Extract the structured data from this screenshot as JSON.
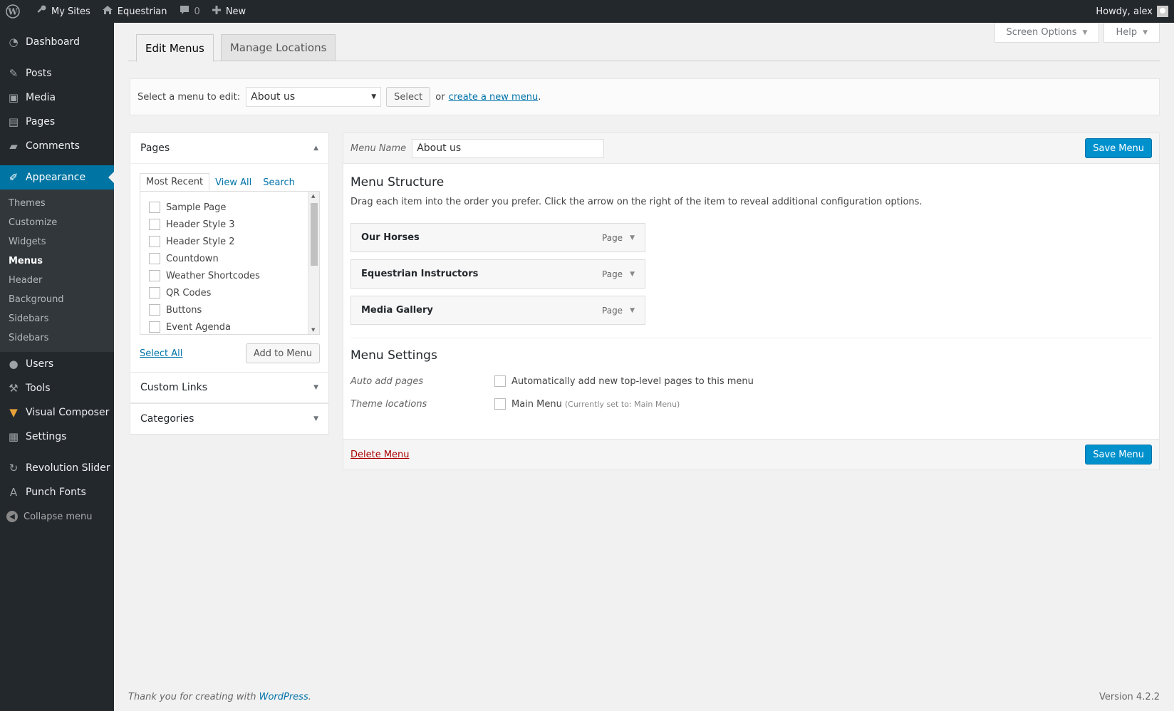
{
  "adminbar": {
    "my_sites": "My Sites",
    "site_name": "Equestrian",
    "comments_count": "0",
    "new_label": "New",
    "howdy": "Howdy, alex"
  },
  "sidebar": {
    "items": [
      {
        "label": "Dashboard",
        "icon": "dashboard-icon"
      },
      {
        "label": "Posts",
        "icon": "pin-icon"
      },
      {
        "label": "Media",
        "icon": "media-icon"
      },
      {
        "label": "Pages",
        "icon": "page-icon"
      },
      {
        "label": "Comments",
        "icon": "comment-icon"
      },
      {
        "label": "Appearance",
        "icon": "brush-icon"
      }
    ],
    "submenu": [
      "Themes",
      "Customize",
      "Widgets",
      "Menus",
      "Header",
      "Background",
      "Sidebars",
      "Sidebars"
    ],
    "lower_items": [
      {
        "label": "Users",
        "icon": "user-icon"
      },
      {
        "label": "Tools",
        "icon": "wrench-icon"
      },
      {
        "label": "Visual Composer",
        "icon": "vc-icon"
      },
      {
        "label": "Settings",
        "icon": "settings-icon"
      },
      {
        "label": "Revolution Slider",
        "icon": "refresh-icon"
      },
      {
        "label": "Punch Fonts",
        "icon": "font-icon"
      }
    ],
    "collapse": "Collapse menu"
  },
  "screen_meta": {
    "screen_options": "Screen Options",
    "help": "Help"
  },
  "tabs": [
    "Edit Menus",
    "Manage Locations"
  ],
  "select_bar": {
    "label": "Select a menu to edit:",
    "selected": "About us",
    "select_button": "Select",
    "or": "or",
    "create_link": "create a new menu",
    "period": "."
  },
  "pages_box": {
    "title": "Pages",
    "tabs": [
      "Most Recent",
      "View All",
      "Search"
    ],
    "items": [
      "Sample Page",
      "Header Style 3",
      "Header Style 2",
      "Countdown",
      "Weather Shortcodes",
      "QR Codes",
      "Buttons",
      "Event Agenda"
    ],
    "select_all": "Select All",
    "add_button": "Add to Menu"
  },
  "custom_links_title": "Custom Links",
  "categories_title": "Categories",
  "menu_edit": {
    "name_label": "Menu Name",
    "name_value": "About us",
    "save_button": "Save Menu",
    "structure_title": "Menu Structure",
    "structure_desc": "Drag each item into the order you prefer. Click the arrow on the right of the item to reveal additional configuration options.",
    "menu_items": [
      {
        "title": "Our Horses",
        "type": "Page"
      },
      {
        "title": "Equestrian Instructors",
        "type": "Page"
      },
      {
        "title": "Media Gallery",
        "type": "Page"
      }
    ],
    "settings_title": "Menu Settings",
    "auto_add_label": "Auto add pages",
    "auto_add_text": "Automatically add new top-level pages to this menu",
    "theme_loc_label": "Theme locations",
    "theme_loc_text": "Main Menu",
    "theme_loc_note": "(Currently set to: Main Menu)",
    "delete_link": "Delete Menu"
  },
  "footer": {
    "thanks": "Thank you for creating with",
    "wp_link": "WordPress",
    "period": ".",
    "version": "Version 4.2.2"
  },
  "colors": {
    "adminbar": "#23282d",
    "accent": "#0074a2",
    "primary_button": "#0091cd",
    "link": "#0073aa",
    "delete": "#aa0000"
  }
}
